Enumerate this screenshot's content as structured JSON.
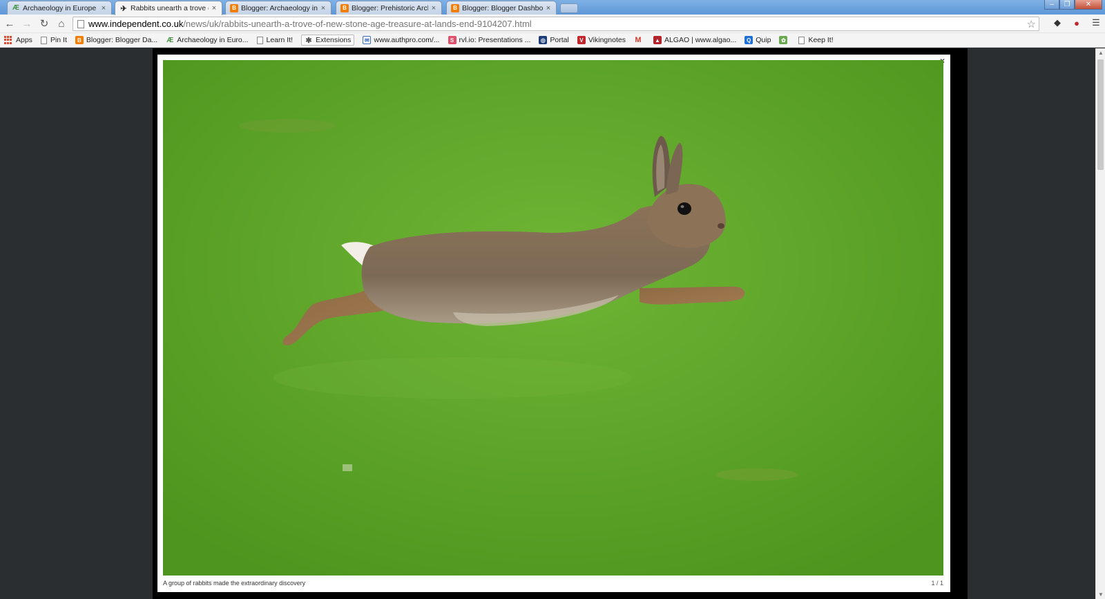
{
  "tabs": [
    {
      "label": "Archaeology in Europe - A",
      "favicon": "ae-icon",
      "color": "#3f8f3f",
      "active": false
    },
    {
      "label": "Rabbits unearth a trove of",
      "favicon": "eagle-icon",
      "color": "#222222",
      "active": true
    },
    {
      "label": "Blogger: Archaeology in E",
      "favicon": "blogger-icon",
      "color": "#f57d00",
      "active": false
    },
    {
      "label": "Blogger: Prehistoric Archa",
      "favicon": "blogger-icon",
      "color": "#f57d00",
      "active": false
    },
    {
      "label": "Blogger: Blogger Dashboa",
      "favicon": "blogger-icon",
      "color": "#f57d00",
      "active": false
    }
  ],
  "address": {
    "host": "www.independent.co.uk",
    "path": "/news/uk/rabbits-unearth-a-trove-of-new-stone-age-treasure-at-lands-end-9104207.html"
  },
  "bookmarks": [
    {
      "label": "Apps",
      "icon": "apps-grid-icon"
    },
    {
      "label": "Pin It",
      "icon": "page-icon"
    },
    {
      "label": "Blogger: Blogger Da...",
      "icon": "blogger-icon",
      "color": "#f57d00"
    },
    {
      "label": "Archaeology in Euro...",
      "icon": "ae-icon",
      "color": "#3f8f3f"
    },
    {
      "label": "Learn It!",
      "icon": "page-icon"
    },
    {
      "label": "Extensions",
      "icon": "puzzle-icon",
      "boxed": true
    },
    {
      "label": "www.authpro.com/...",
      "icon": "authpro-icon",
      "color": "#3a6fc2"
    },
    {
      "label": "rvl.io: Presentations ...",
      "icon": "slides-icon",
      "color": "#e0506a"
    },
    {
      "label": "Portal",
      "icon": "portal-icon",
      "color": "#1c3d7a"
    },
    {
      "label": "Vikingnotes",
      "icon": "viking-icon",
      "color": "#c0262b"
    },
    {
      "label": "",
      "icon": "gmail-icon",
      "color": "#d23b2e"
    },
    {
      "label": "ALGAO | www.algao...",
      "icon": "algao-icon",
      "color": "#b32329"
    },
    {
      "label": "Quip",
      "icon": "quip-icon",
      "color": "#1e6fd6"
    },
    {
      "label": "",
      "icon": "picasa-icon",
      "color": "#6aa84f"
    },
    {
      "label": "Keep It!",
      "icon": "page-icon"
    }
  ],
  "lightbox": {
    "close_label": "×",
    "caption": "A group of rabbits made the extraordinary discovery",
    "counter": "1 / 1",
    "image_subject": "rabbit-photo"
  }
}
